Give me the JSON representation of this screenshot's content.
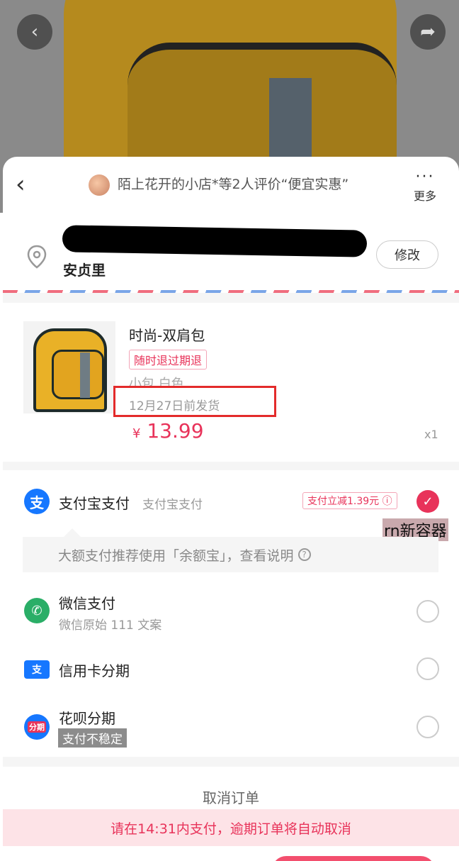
{
  "background": {
    "back_icon": "chevron-left-icon",
    "share_icon": "share-icon"
  },
  "header": {
    "back_icon": "chevron-left-icon",
    "review_text": "陌上花开的小店*等2人评价“便宜实惠”",
    "more_label": "更多"
  },
  "address": {
    "line1": "[redacted]",
    "line2": "安贞里",
    "edit_label": "修改"
  },
  "product": {
    "title": "时尚-双肩包",
    "tag": "随时退过期退",
    "spec": "小包 白色",
    "ship_date": "12月27日前发货",
    "currency": "¥",
    "price": "13.99",
    "qty": "x1"
  },
  "payments": {
    "alipay": {
      "icon": "alipay-icon",
      "name": "支付宝支付",
      "sub": "支付宝支付",
      "promo": "支付立减1.39元 ⓘ",
      "selected": true
    },
    "rn_tag": "rn新容器",
    "tip": "大额支付推荐使用「余额宝」，查看说明",
    "wechat": {
      "icon": "wechat-icon",
      "name": "微信支付",
      "sub": "微信原始 111 文案"
    },
    "credit": {
      "icon": "credit-card-icon",
      "name": "信用卡分期"
    },
    "huabei": {
      "icon": "huabei-icon",
      "icon_text": "分期",
      "name": "花呗分期",
      "sub": "支付不稳定"
    }
  },
  "footer": {
    "cancel_label": "取消订单",
    "timer_text": "请在14:31内支付，逾期订单将自动取消"
  },
  "colors": {
    "accent": "#e8335a",
    "alipay": "#1677ff",
    "wechat": "#2aae67"
  }
}
